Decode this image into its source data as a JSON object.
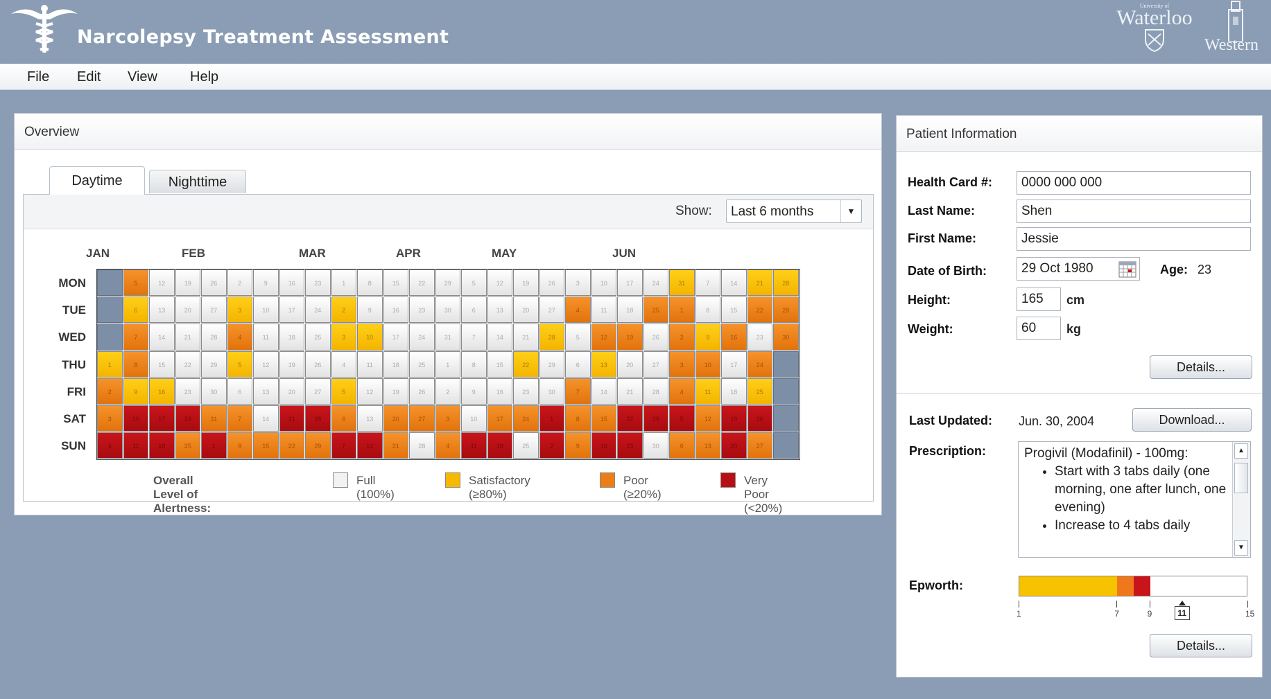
{
  "app": {
    "title": "Narcolepsy Treatment Assessment",
    "uw_small": "University of",
    "uw_name": "Waterloo",
    "western_name": "Western"
  },
  "menu": [
    "File",
    "Edit",
    "View",
    "Help"
  ],
  "overview": {
    "title": "Overview",
    "tabs": [
      "Daytime",
      "Nighttime"
    ],
    "show_label": "Show:",
    "show_value": "Last 6 months",
    "months": [
      "JAN",
      "FEB",
      "MAR",
      "APR",
      "MAY",
      "JUN"
    ],
    "days": [
      "MON",
      "TUE",
      "WED",
      "THU",
      "FRI",
      "SAT",
      "SUN"
    ],
    "calendar": [
      [
        "E",
        "O5",
        "F12",
        "F19",
        "F26",
        "F2",
        "F9",
        "F16",
        "F23",
        "F1",
        "F8",
        "F15",
        "F22",
        "F29",
        "F5",
        "F12",
        "F19",
        "F26",
        "F3",
        "F10",
        "F17",
        "F24",
        "Y31",
        "F7",
        "F14",
        "Y21",
        "Y28"
      ],
      [
        "E",
        "Y6",
        "F13",
        "F20",
        "F27",
        "Y3",
        "F10",
        "F17",
        "F24",
        "Y2",
        "F9",
        "F16",
        "F23",
        "F30",
        "F6",
        "F13",
        "F20",
        "F27",
        "O4",
        "F11",
        "F18",
        "O25",
        "O1",
        "F8",
        "F15",
        "O22",
        "O29"
      ],
      [
        "E",
        "O7",
        "F14",
        "F21",
        "F28",
        "O4",
        "F11",
        "F18",
        "F25",
        "Y3",
        "Y10",
        "F17",
        "F24",
        "F31",
        "F7",
        "F14",
        "F21",
        "Y28",
        "F5",
        "O12",
        "O19",
        "F26",
        "O2",
        "Y9",
        "O16",
        "F23",
        "O30"
      ],
      [
        "Y1",
        "O8",
        "F15",
        "F22",
        "F29",
        "Y5",
        "F12",
        "F19",
        "F26",
        "F4",
        "F11",
        "F18",
        "F25",
        "F1",
        "F8",
        "F15",
        "Y22",
        "F29",
        "F6",
        "Y13",
        "F20",
        "F27",
        "O3",
        "O10",
        "F17",
        "O24",
        "E"
      ],
      [
        "O2",
        "Y9",
        "Y16",
        "F23",
        "F30",
        "F6",
        "F13",
        "F20",
        "F27",
        "Y5",
        "F12",
        "F19",
        "F26",
        "F2",
        "F9",
        "F16",
        "F23",
        "F30",
        "O7",
        "F14",
        "F21",
        "F28",
        "O4",
        "Y11",
        "F18",
        "Y25",
        "E"
      ],
      [
        "O3",
        "R10",
        "R17",
        "R24",
        "O31",
        "O7",
        "F14",
        "R21",
        "R28",
        "O6",
        "F13",
        "O20",
        "O27",
        "O3",
        "F10",
        "O17",
        "O24",
        "R1",
        "O8",
        "O15",
        "R22",
        "R29",
        "R5",
        "O12",
        "R19",
        "R26",
        "E"
      ],
      [
        "R4",
        "R11",
        "R18",
        "O25",
        "R1",
        "O8",
        "O15",
        "O22",
        "O29",
        "R7",
        "R14",
        "O21",
        "F28",
        "O4",
        "R11",
        "R18",
        "F25",
        "R2",
        "O9",
        "R16",
        "R23",
        "F30",
        "O6",
        "O13",
        "R20",
        "O27",
        "E"
      ]
    ],
    "legend": {
      "title": "Overall Level of Alertness:",
      "items": [
        {
          "label": "Full (100%)",
          "color": "#f2f2f2"
        },
        {
          "label": "Satisfactory (≥80%)",
          "color": "#f7b800"
        },
        {
          "label": "Poor (≥20%)",
          "color": "#ea7f18"
        },
        {
          "label": "Very Poor (<20%)",
          "color": "#b80f14"
        }
      ]
    }
  },
  "patient": {
    "title": "Patient Information",
    "health_card_label": "Health Card #:",
    "health_card": "0000 000 000",
    "last_name_label": "Last Name:",
    "last_name": "Shen",
    "first_name_label": "First Name:",
    "first_name": "Jessie",
    "dob_label": "Date of Birth:",
    "dob": "29 Oct 1980",
    "age_label": "Age:",
    "age": "23",
    "height_label": "Height:",
    "height": "165",
    "height_unit": "cm",
    "weight_label": "Weight:",
    "weight": "60",
    "weight_unit": "kg",
    "details_label": "Details...",
    "last_updated_label": "Last Updated:",
    "last_updated": "Jun. 30, 2004",
    "download_label": "Download...",
    "prescription_label": "Prescription:",
    "prescription_title": "Progivil (Modafinil) - 100mg:",
    "prescription_items": [
      "Start with 3 tabs daily (one morning, one after lunch, one evening)",
      "Increase to 4 tabs daily"
    ],
    "epworth_label": "Epworth:",
    "epworth_score": "11",
    "epworth_scale": {
      "min": 1,
      "max": 15,
      "ticks": [
        "1",
        "7",
        "9",
        "15"
      ],
      "score": 11
    },
    "epworth_segments": [
      {
        "from": 1,
        "to": 7,
        "color": "#f7c300"
      },
      {
        "from": 7,
        "to": 8,
        "color": "#f0781c"
      },
      {
        "from": 8,
        "to": 9,
        "color": "#c8141a"
      }
    ],
    "details2_label": "Details..."
  }
}
